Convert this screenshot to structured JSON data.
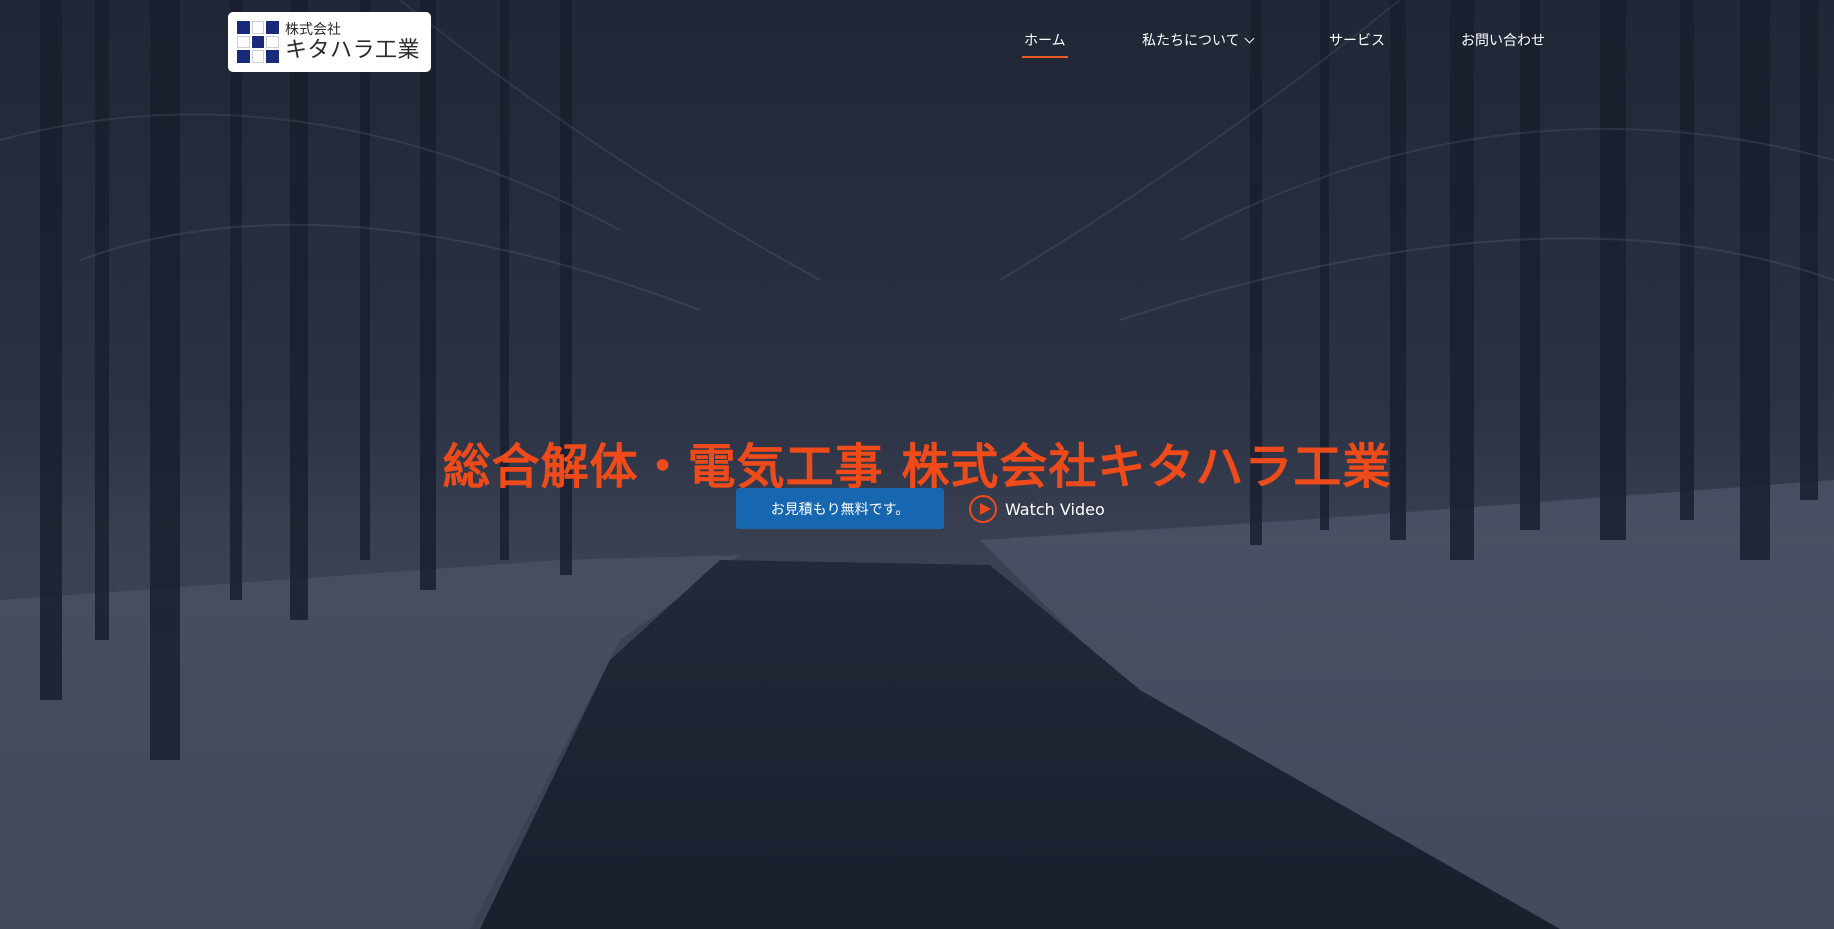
{
  "header": {
    "logo": {
      "small_text": "株式会社",
      "large_text": "キタハラ工業",
      "icon": "checkered-grid-logo-icon"
    },
    "nav": [
      {
        "label": "ホーム",
        "active": true
      },
      {
        "label": "私たちについて",
        "has_dropdown": true,
        "icon": "chevron-down-icon"
      },
      {
        "label": "サービス"
      },
      {
        "label": "お問い合わせ"
      }
    ]
  },
  "hero": {
    "headline": "総合解体・電気工事 株式会社キタハラ工業",
    "cta_label": "お見積もり無料です。",
    "watch_label": "Watch Video",
    "watch_icon": "play-circle-icon"
  },
  "colors": {
    "accent": "#ef4b1a",
    "cta_bg": "#1766b0",
    "logo_mark": "#1a2a7a"
  }
}
